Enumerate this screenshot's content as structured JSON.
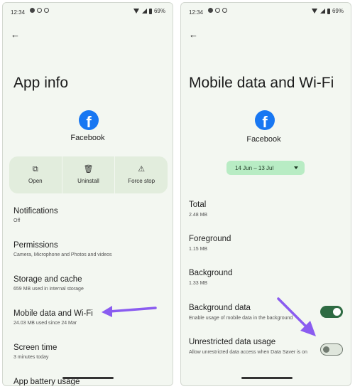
{
  "left_screen": {
    "status": {
      "time": "12:34",
      "battery": "69%"
    },
    "title": "App info",
    "app_name": "Facebook",
    "app_logo_glyph": "f",
    "actions": [
      {
        "label": "Open",
        "icon": "open-external-icon",
        "glyph": "⧉"
      },
      {
        "label": "Uninstall",
        "icon": "trash-icon",
        "glyph": "🗑"
      },
      {
        "label": "Force stop",
        "icon": "warning-icon",
        "glyph": "⚠"
      }
    ],
    "items": [
      {
        "label": "Notifications",
        "sub": "Off"
      },
      {
        "label": "Permissions",
        "sub": "Camera, Microphone and Photos and videos"
      },
      {
        "label": "Storage and cache",
        "sub": "659 MB used in internal storage"
      },
      {
        "label": "Mobile data and Wi-Fi",
        "sub": "24.03 MB used since 24 Mar"
      },
      {
        "label": "Screen time",
        "sub": "3 minutes today"
      },
      {
        "label": "App battery usage",
        "sub": ""
      }
    ]
  },
  "right_screen": {
    "status": {
      "time": "12:34",
      "battery": "69%"
    },
    "title": "Mobile data and Wi-Fi",
    "app_name": "Facebook",
    "app_logo_glyph": "f",
    "date_range": "14 Jun – 13 Jul",
    "usage": [
      {
        "label": "Total",
        "value": "2.48 MB"
      },
      {
        "label": "Foreground",
        "value": "1.15 MB"
      },
      {
        "label": "Background",
        "value": "1.33 MB"
      }
    ],
    "background_data": {
      "label": "Background data",
      "sub": "Enable usage of mobile data in the background",
      "enabled": true
    },
    "unrestricted": {
      "label": "Unrestricted data usage",
      "sub": "Allow unrestricted data access when Data Saver is on",
      "enabled": false
    }
  },
  "colors": {
    "accent_arrow": "#8a5cf0",
    "toggle_on": "#2e6b43",
    "facebook_blue": "#1877f2",
    "date_pill": "#b8ecc4"
  }
}
